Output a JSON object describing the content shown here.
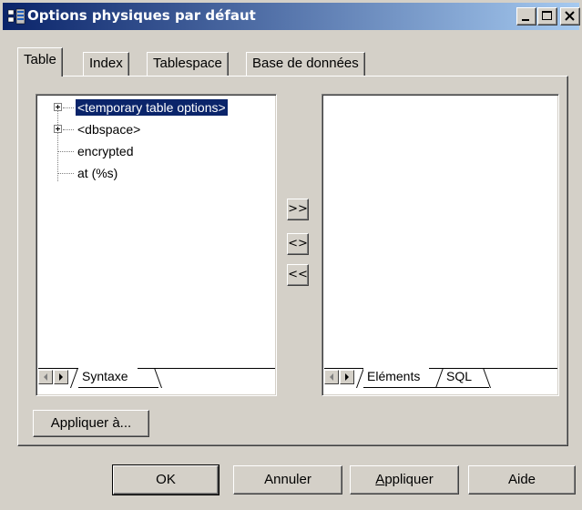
{
  "window": {
    "title": "Options physiques par défaut"
  },
  "tabs": [
    {
      "label": "Table",
      "active": true
    },
    {
      "label": "Index",
      "active": false
    },
    {
      "label": "Tablespace",
      "active": false
    },
    {
      "label": "Base de données",
      "active": false
    }
  ],
  "syntax_tree": {
    "items": [
      {
        "label": "<temporary table options>",
        "expandable": true,
        "selected": true
      },
      {
        "label": "<dbspace>",
        "expandable": true,
        "selected": false
      },
      {
        "label": "encrypted",
        "expandable": false,
        "selected": false
      },
      {
        "label": "at (%s)",
        "expandable": false,
        "selected": false
      }
    ]
  },
  "left_box": {
    "tabs": [
      "Syntaxe"
    ]
  },
  "right_box": {
    "tabs": [
      "Eléments",
      "SQL"
    ]
  },
  "move_buttons": {
    "add": ">>",
    "swap": "<>",
    "remove": "<<"
  },
  "apply_to_label": "Appliquer à...",
  "footer": {
    "ok": "OK",
    "cancel": "Annuler",
    "apply": "Appliquer",
    "help": "Aide"
  },
  "colors": {
    "titlebar_start": "#0a246a",
    "titlebar_end": "#a6caf0",
    "selection": "#0a246a",
    "face": "#d4d0c8"
  }
}
